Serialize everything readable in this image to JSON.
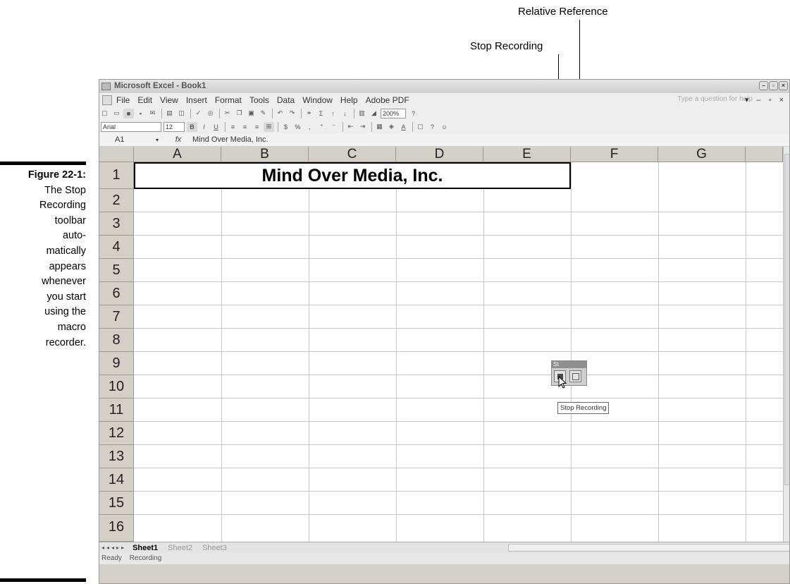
{
  "callouts": {
    "relative_reference": "Relative Reference",
    "stop_recording": "Stop Recording"
  },
  "caption": {
    "figure": "Figure 22-1:",
    "lines": [
      "The Stop",
      "Recording",
      "toolbar",
      "auto-",
      "matically",
      "appears",
      "whenever",
      "you start",
      "using the",
      "macro",
      "recorder."
    ]
  },
  "window": {
    "title": "Microsoft Excel - Book1",
    "menu": [
      "File",
      "Edit",
      "View",
      "Insert",
      "Format",
      "Tools",
      "Data",
      "Window",
      "Help",
      "Adobe PDF"
    ],
    "help_placeholder": "Type a question for help",
    "zoom": "200%",
    "font_name": "Arial",
    "font_size": "12",
    "name_box": "A1",
    "fx_symbol": "fx",
    "formula": "Mind Over Media, Inc."
  },
  "sheet": {
    "columns": [
      "A",
      "B",
      "C",
      "D",
      "E",
      "F",
      "G"
    ],
    "rows": [
      "1",
      "2",
      "3",
      "4",
      "5",
      "6",
      "7",
      "8",
      "9",
      "10",
      "11",
      "12",
      "13",
      "14",
      "15",
      "16"
    ],
    "title_cell": "Mind Over Media, Inc."
  },
  "stop_toolbar": {
    "title": "St",
    "tooltip": "Stop Recording"
  },
  "tabs": [
    "Sheet1",
    "Sheet2",
    "Sheet3"
  ],
  "status": {
    "ready": "Ready",
    "recording": "Recording"
  }
}
